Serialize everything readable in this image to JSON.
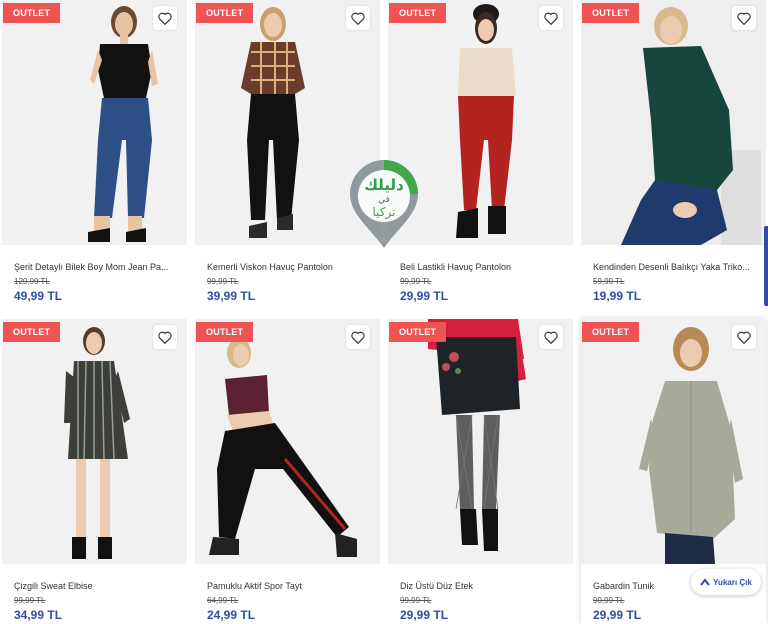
{
  "colors": {
    "outlet_badge": "#ef5454",
    "price": "#2f4ea8",
    "photo_bg": "#f0f0f0"
  },
  "products": [
    {
      "badge": "OUTLET",
      "name": "Şerit Detaylı Bilek Boy Mom Jean Pa...",
      "old_price": "129,99 TL",
      "price": "49,99 TL"
    },
    {
      "badge": "OUTLET",
      "name": "Kemerli Viskon Havuç Pantolon",
      "old_price": "99,99 TL",
      "price": "39,99 TL"
    },
    {
      "badge": "OUTLET",
      "name": "Beli Lastikli Havuç Pantolon",
      "old_price": "99,99 TL",
      "price": "29,99 TL"
    },
    {
      "badge": "OUTLET",
      "name": "Kendinden Desenli Balıkçı Yaka Triko...",
      "old_price": "59,99 TL",
      "price": "19,99 TL"
    },
    {
      "badge": "OUTLET",
      "name": "Çizgili Sweat Elbise",
      "old_price": "99,99 TL",
      "price": "34,99 TL"
    },
    {
      "badge": "OUTLET",
      "name": "Pamuklu Aktif Spor Tayt",
      "old_price": "64,99 TL",
      "price": "24,99 TL"
    },
    {
      "badge": "OUTLET",
      "name": "Diz Üstü Düz Etek",
      "old_price": "99,99 TL",
      "price": "29,99 TL"
    },
    {
      "badge": "OUTLET",
      "name": "Gabardin Tunik",
      "old_price": "99,99 TL",
      "price": "29,99 TL"
    }
  ],
  "watermark": {
    "line1": "دليلك",
    "line2": "في",
    "line3": "تركيا"
  },
  "back_to_top": {
    "label": "Yukarı Çık"
  }
}
